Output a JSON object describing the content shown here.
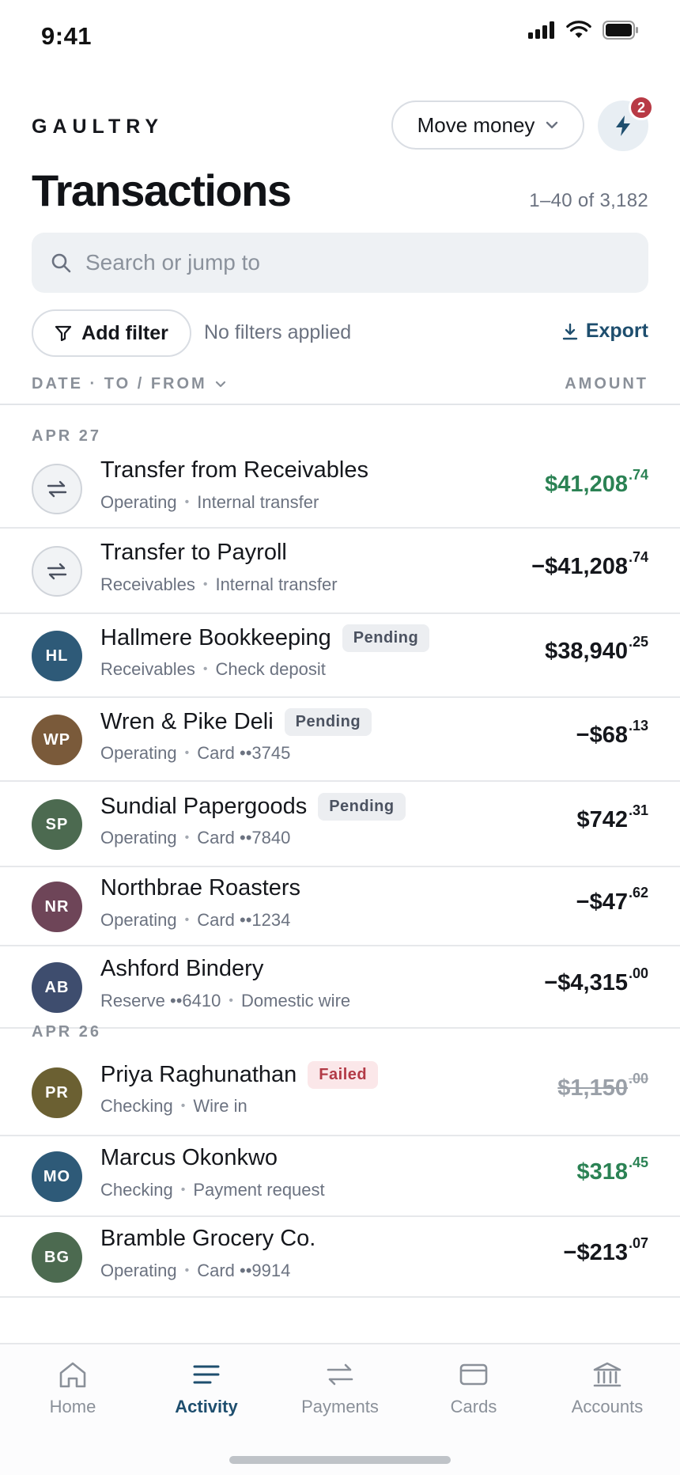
{
  "status_bar": {
    "time": "9:41"
  },
  "header": {
    "brand": "GAULTRY",
    "move_money_label": "Move money",
    "notification_count": "2",
    "title": "Transactions",
    "range": "1–40 of 3,182"
  },
  "search": {
    "placeholder": "Search or jump to"
  },
  "filters": {
    "add_filter_label": "Add filter",
    "status": "No filters applied",
    "export_label": "Export"
  },
  "columns": {
    "left": "DATE · TO / FROM",
    "right": "AMOUNT"
  },
  "sections": [
    {
      "label": "APR 27",
      "rows": [
        {
          "name": "Transfer from Receivables",
          "badge": "",
          "sub_a": "Operating",
          "sub_b": "Internal transfer",
          "avatar_type": "transfer",
          "initials": "",
          "amount": "$41,208",
          "cents": ".74",
          "amount_type": "credit"
        },
        {
          "name": "Transfer to Payroll",
          "badge": "",
          "sub_a": "Receivables",
          "sub_b": "Internal transfer",
          "avatar_type": "transfer",
          "initials": "",
          "amount": "−$41,208",
          "cents": ".74",
          "amount_type": "debit"
        },
        {
          "name": "Hallmere Bookkeeping",
          "badge": "Pending",
          "sub_a": "Receivables",
          "sub_b": "Check deposit",
          "avatar_type": "initials",
          "initials": "HL",
          "avatar_color": "#2e5a78",
          "amount": "$38,940",
          "cents": ".25",
          "amount_type": "debit"
        },
        {
          "name": "Wren & Pike Deli",
          "badge": "Pending",
          "sub_a": "Operating",
          "sub_b": "Card ••3745",
          "avatar_type": "initials",
          "initials": "WP",
          "avatar_color": "#7a5a3a",
          "amount": "−$68",
          "cents": ".13",
          "amount_type": "debit"
        },
        {
          "name": "Sundial Papergoods",
          "badge": "Pending",
          "sub_a": "Operating",
          "sub_b": "Card ••7840",
          "avatar_type": "initials",
          "initials": "SP",
          "avatar_color": "#4c6a50",
          "amount": "$742",
          "cents": ".31",
          "amount_type": "debit"
        },
        {
          "name": "Northbrae Roasters",
          "badge": "",
          "sub_a": "Operating",
          "sub_b": "Card ••1234",
          "avatar_type": "initials",
          "initials": "NR",
          "avatar_color": "#6e4558",
          "amount": "−$47",
          "cents": ".62",
          "amount_type": "debit"
        },
        {
          "name": "Ashford Bindery",
          "badge": "",
          "sub_a": "Reserve ••6410",
          "sub_b": "Domestic wire",
          "avatar_type": "initials",
          "initials": "AB",
          "avatar_color": "#3e4d6e",
          "amount": "−$4,315",
          "cents": ".00",
          "amount_type": "debit"
        }
      ]
    },
    {
      "label": "APR 26",
      "rows": [
        {
          "name": "Priya Raghunathan",
          "badge": "Failed",
          "sub_a": "Checking",
          "sub_b": "Wire in",
          "avatar_type": "initials",
          "initials": "PR",
          "avatar_color": "#6b6032",
          "amount": "$1,150",
          "cents": ".00",
          "amount_type": "failed"
        },
        {
          "name": "Marcus Okonkwo",
          "badge": "",
          "sub_a": "Checking",
          "sub_b": "Payment request",
          "avatar_type": "initials",
          "initials": "MO",
          "avatar_color": "#2e5a78",
          "amount": "$318",
          "cents": ".45",
          "amount_type": "credit"
        },
        {
          "name": "Bramble Grocery Co.",
          "badge": "",
          "sub_a": "Operating",
          "sub_b": "Card ••9914",
          "avatar_type": "initials",
          "initials": "BG",
          "avatar_color": "#4c6a50",
          "amount": "−$213",
          "cents": ".07",
          "amount_type": "debit"
        }
      ]
    }
  ],
  "tab_bar": {
    "tabs": [
      {
        "label": "Home",
        "icon": "home-icon",
        "active": false
      },
      {
        "label": "Activity",
        "icon": "activity-icon",
        "active": true
      },
      {
        "label": "Payments",
        "icon": "payments-icon",
        "active": false
      },
      {
        "label": "Cards",
        "icon": "card-icon",
        "active": false
      },
      {
        "label": "Accounts",
        "icon": "bank-icon",
        "active": false
      }
    ]
  },
  "colors": {
    "accent": "#1e4e6e",
    "credit": "#2b8254",
    "failed_badge": "#b23a46",
    "notification": "#b83a45"
  }
}
